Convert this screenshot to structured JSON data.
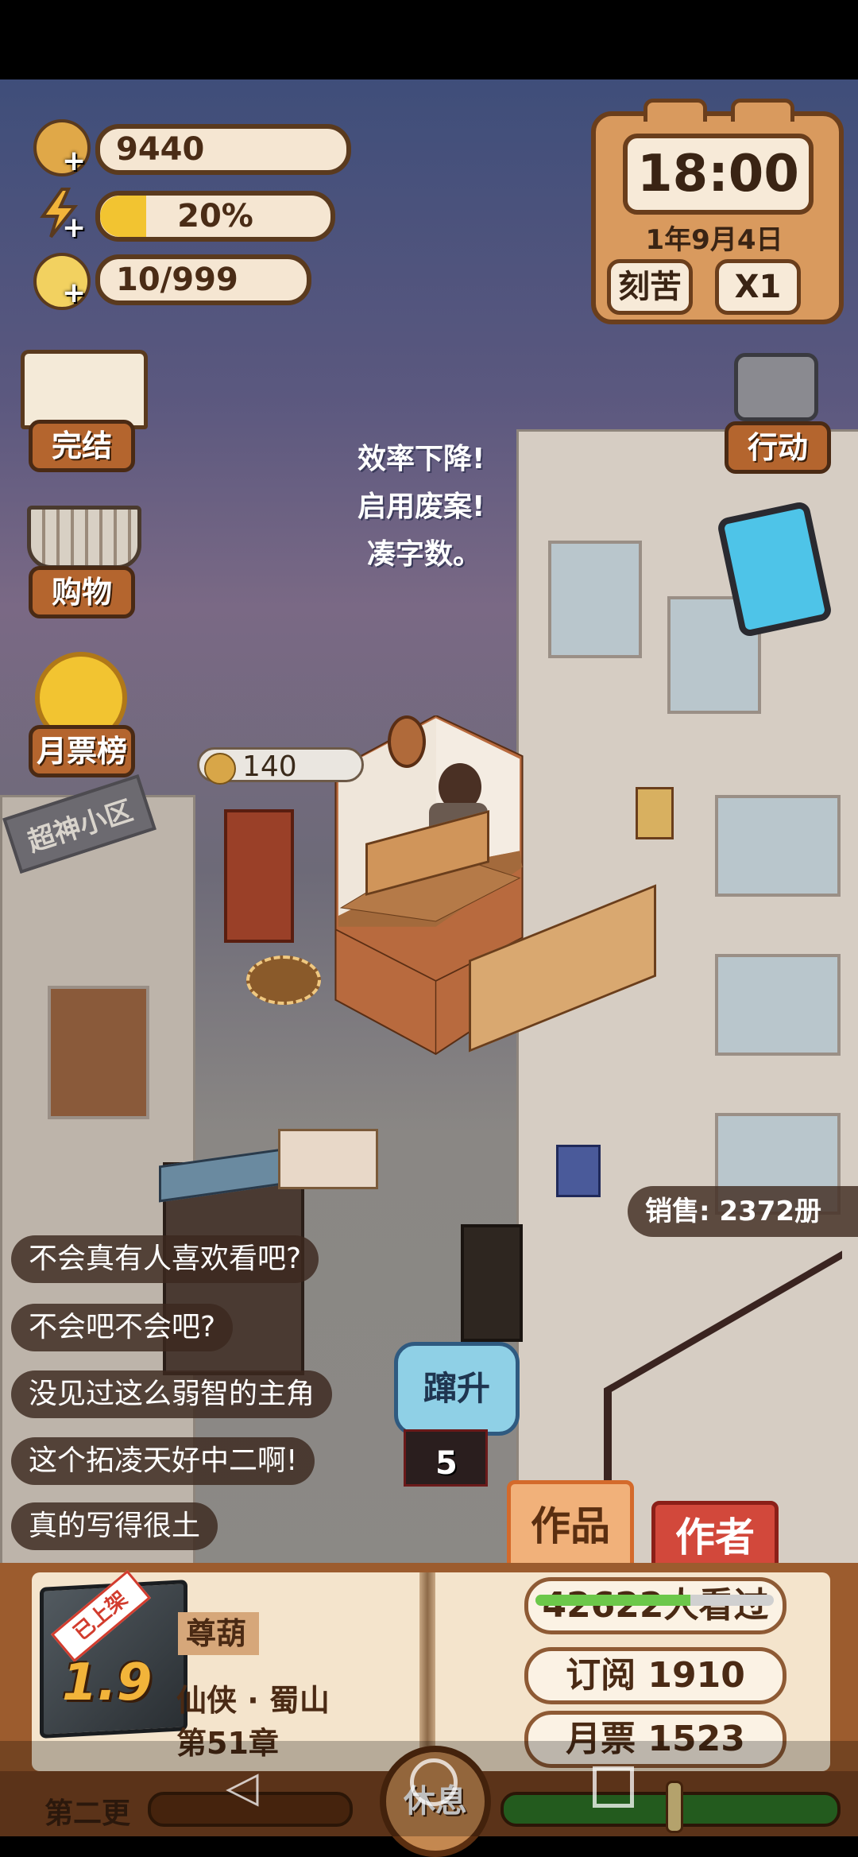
{
  "resources": {
    "coins": "9440",
    "energy": "20%",
    "energy_level": 0.2,
    "inspiration": "10/999",
    "plus": "+"
  },
  "clock": {
    "time": "18:00",
    "date": "1年9月4日",
    "mode_button": "刻苦",
    "speed_button": "X1"
  },
  "left_menu": {
    "finish_label": "完结",
    "shop_label": "购物",
    "ranking_label": "月票榜"
  },
  "right_menu": {
    "action_label": "行动"
  },
  "thought": [
    "效率下降!",
    "启用废案!",
    "凑字数。"
  ],
  "coin_bubble": "140",
  "building_sign": "超神小区",
  "sales": "销售: 2372册",
  "comments": [
    "不会真有人喜欢看吧?",
    "不会吧不会吧?",
    "没见过这么弱智的主角",
    "这个拓凌天好中二啊!",
    "真的写得很土"
  ],
  "soar": {
    "label": "蹿升",
    "count": "5"
  },
  "tabs": {
    "works": "作品",
    "author": "作者"
  },
  "book": {
    "status_ribbon": "已上架",
    "score": "1.9",
    "title": "尊葫",
    "genre": "仙侠 · 蜀山",
    "chapter": "第51章",
    "views": "42622人看过",
    "views_progress": 0.65,
    "subscriptions": "订阅 1910",
    "monthly_tickets": "月票 1523"
  },
  "bottom": {
    "update_label": "第二更",
    "rest_button": "休息"
  },
  "colors": {
    "accent_brown": "#6a3e1c",
    "panel_orange": "#d99a5e",
    "author_red": "#d2483b",
    "soar_blue": "#8fd0e6"
  }
}
